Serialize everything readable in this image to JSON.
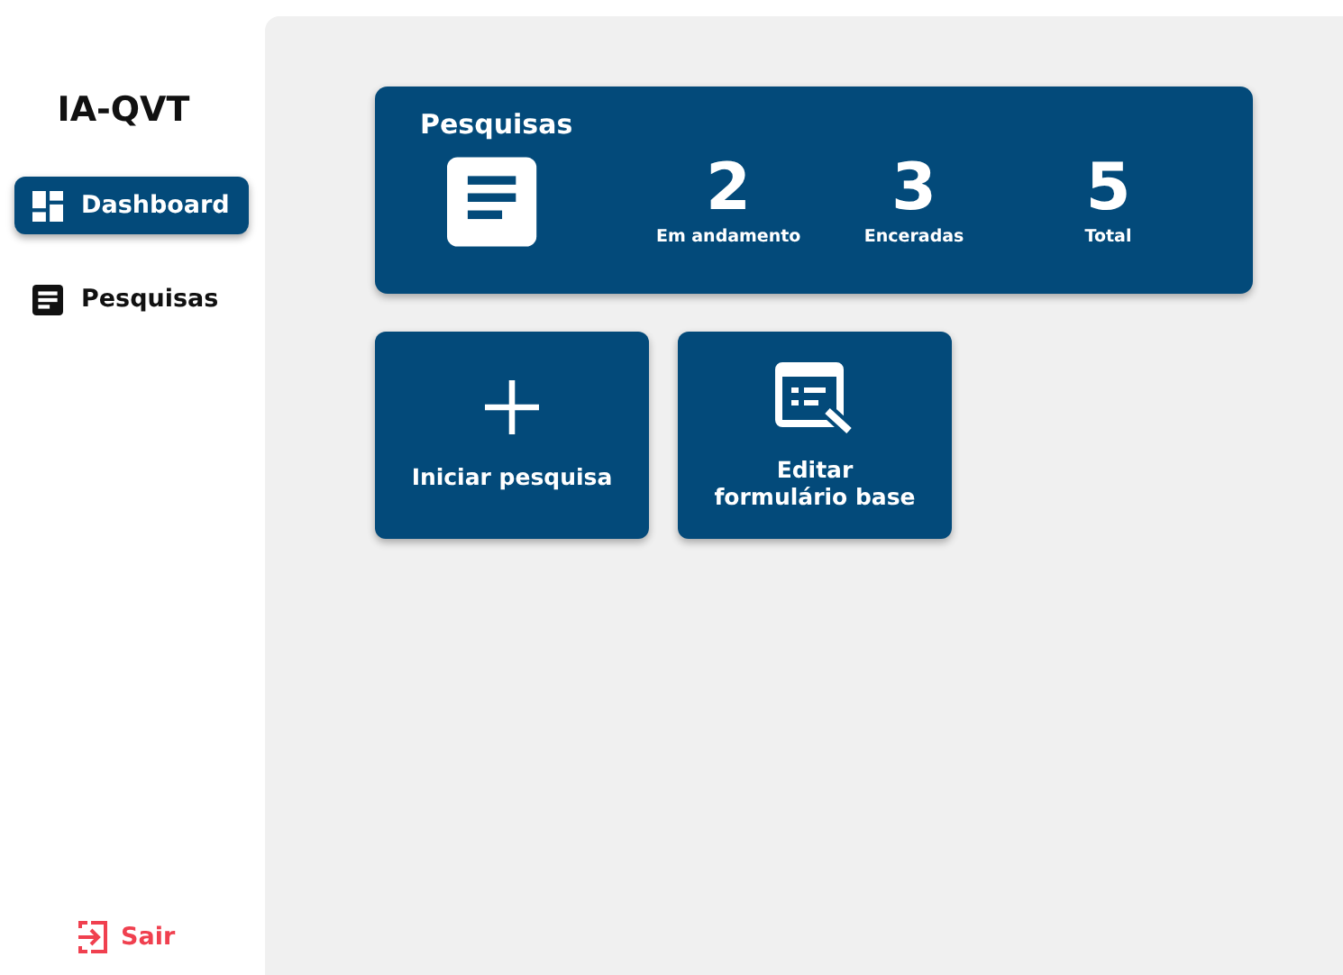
{
  "app_title": "IA-QVT",
  "nav": [
    {
      "kind": "dashboard",
      "label": "Dashboard",
      "selected": true
    },
    {
      "kind": "list",
      "label": "Pesquisas",
      "selected": false
    }
  ],
  "logout": {
    "label": "Sair"
  },
  "summary": {
    "title": "Pesquisas",
    "stats": [
      {
        "value": "2",
        "label": "Em andamento"
      },
      {
        "value": "3",
        "label": "Enceradas"
      },
      {
        "value": "5",
        "label": "Total"
      }
    ]
  },
  "actions": [
    {
      "kind": "add",
      "label": "Iniciar pesquisa"
    },
    {
      "kind": "edit_form",
      "label": "Editar formulário base"
    }
  ]
}
